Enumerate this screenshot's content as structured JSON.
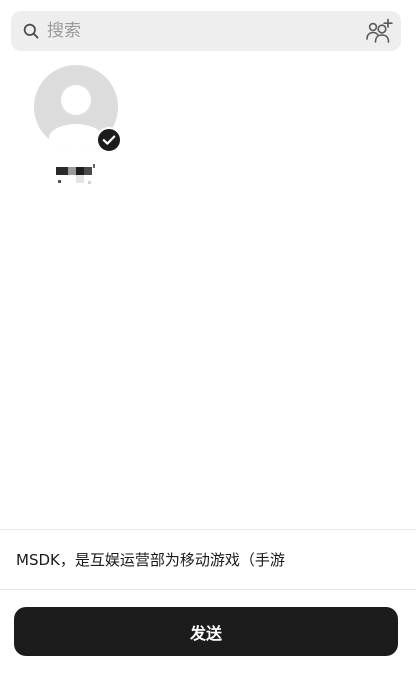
{
  "search": {
    "placeholder": "搜索",
    "icon": "search-icon",
    "add_icon": "add-friend-icon"
  },
  "contacts": [
    {
      "avatar_icon": "default-avatar-icon",
      "selected": true,
      "badge_icon": "check-icon"
    }
  ],
  "message": {
    "preview": "MSDK，是互娱运营部为移动游戏（手游"
  },
  "footer": {
    "send_label": "发送"
  },
  "colors": {
    "search_bg": "#eeeeee",
    "avatar_bg": "#dcdcdc",
    "avatar_fg": "#ffffff",
    "badge_bg": "#1c1c1c",
    "button_bg": "#1c1c1c",
    "button_text": "#ffffff",
    "placeholder": "#9b9b9b"
  }
}
